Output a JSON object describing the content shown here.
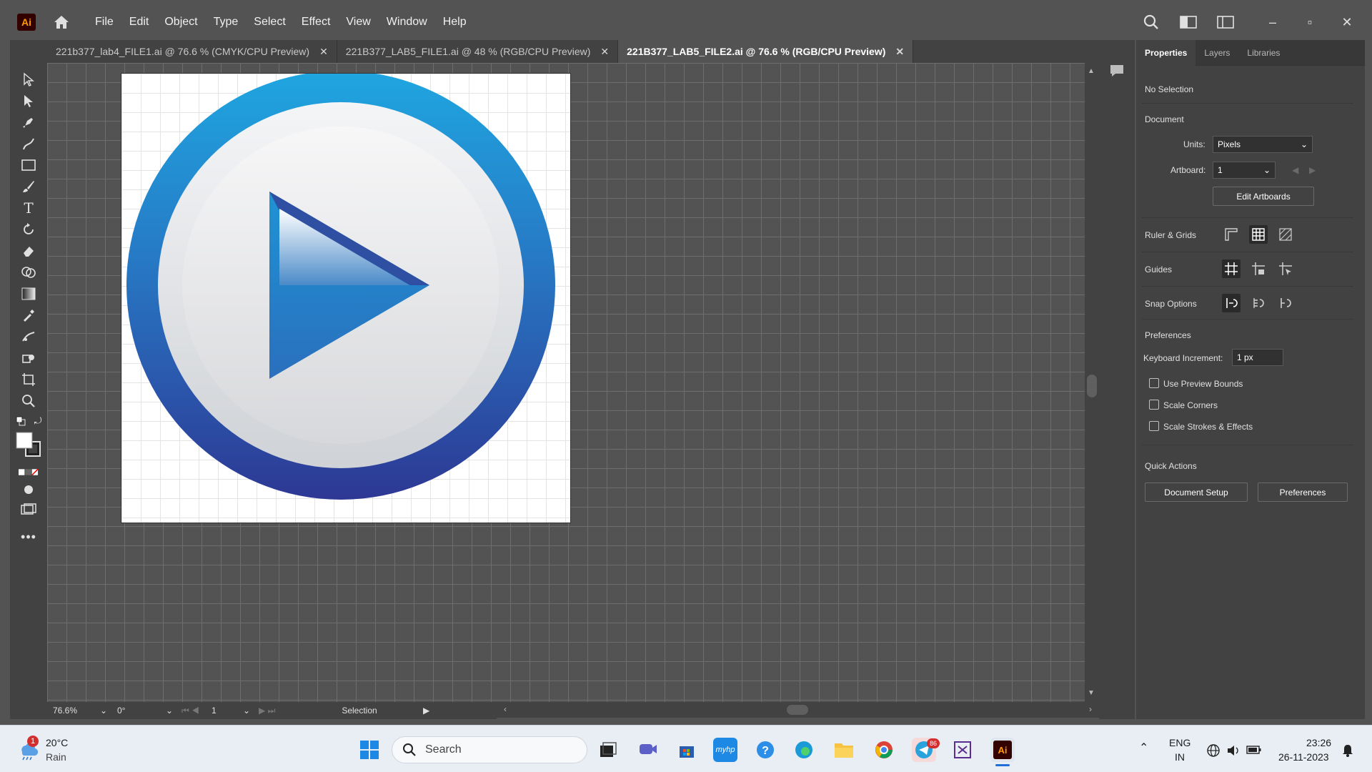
{
  "app": {
    "logo": "Ai"
  },
  "menu": [
    "File",
    "Edit",
    "Object",
    "Type",
    "Select",
    "Effect",
    "View",
    "Window",
    "Help"
  ],
  "tabs": [
    {
      "label": "221b377_lab4_FILE1.ai @ 76.6 % (CMYK/CPU Preview)",
      "active": false
    },
    {
      "label": "221B377_LAB5_FILE1.ai @ 48 % (RGB/CPU Preview)",
      "active": false
    },
    {
      "label": "221B377_LAB5_FILE2.ai @ 76.6 % (RGB/CPU Preview)",
      "active": true
    }
  ],
  "status": {
    "zoom": "76.6%",
    "rotation": "0°",
    "artboard": "1",
    "tool": "Selection"
  },
  "panel": {
    "tabs": [
      "Properties",
      "Layers",
      "Libraries"
    ],
    "selection": "No Selection",
    "document_heading": "Document",
    "units_label": "Units:",
    "units_value": "Pixels",
    "artboard_label": "Artboard:",
    "artboard_value": "1",
    "edit_artboards": "Edit Artboards",
    "ruler_grids": "Ruler & Grids",
    "guides": "Guides",
    "snap_options": "Snap Options",
    "preferences_heading": "Preferences",
    "keyboard_increment_label": "Keyboard Increment:",
    "keyboard_increment_value": "1 px",
    "use_preview_bounds": "Use Preview Bounds",
    "scale_corners": "Scale Corners",
    "scale_strokes": "Scale Strokes & Effects",
    "quick_actions": "Quick Actions",
    "document_setup": "Document Setup",
    "preferences_button": "Preferences"
  },
  "taskbar": {
    "weather_temp": "20°C",
    "weather_desc": "Rain",
    "weather_badge": "1",
    "search_placeholder": "Search",
    "lang_top": "ENG",
    "lang_bottom": "IN",
    "time": "23:26",
    "date": "26-11-2023",
    "telegram_badge": "86"
  },
  "colors": {
    "accent_blue": "#2496d8",
    "ring_dark": "#2b3c96",
    "app_bg": "#535353",
    "panel_bg": "#424242"
  }
}
